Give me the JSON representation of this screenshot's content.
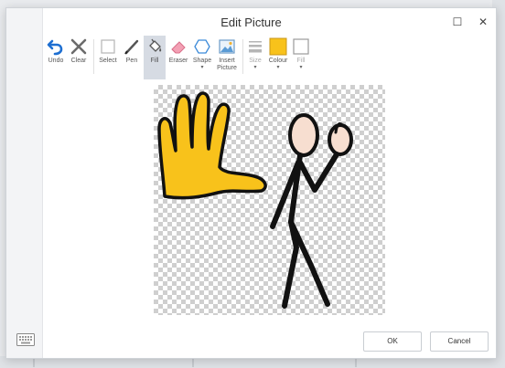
{
  "dialog": {
    "title": "Edit Picture"
  },
  "window_controls": {
    "maximize": "☐",
    "close": "✕"
  },
  "toolbar": {
    "undo": "Undo",
    "clear": "Clear",
    "select": "Select",
    "pen": "Pen",
    "fill": "Fill",
    "eraser": "Eraser",
    "shape": "Shape",
    "insert_picture_1": "Insert",
    "insert_picture_2": "Picture",
    "size": "Size",
    "colour": "Colour",
    "fill2": "Fill",
    "caret": "▾"
  },
  "selected_tool": "fill",
  "colours": {
    "current_colour": "#f8c21b",
    "accent": "#1e6fd1",
    "hand_fill": "#f8c21b",
    "face_fill": "#f7ded0"
  },
  "buttons": {
    "ok": "OK",
    "cancel": "Cancel"
  },
  "icons": {
    "undo": "undo-arrow-icon",
    "clear": "clear-x-icon",
    "select": "select-square-icon",
    "pen": "pen-icon",
    "fill": "paint-bucket-icon",
    "eraser": "eraser-icon",
    "shape": "hexagon-icon",
    "insert_picture": "image-icon",
    "size": "line-size-icon",
    "colour": "colour-swatch-icon",
    "fill2": "fill-swatch-icon",
    "keyboard": "keyboard-icon"
  }
}
